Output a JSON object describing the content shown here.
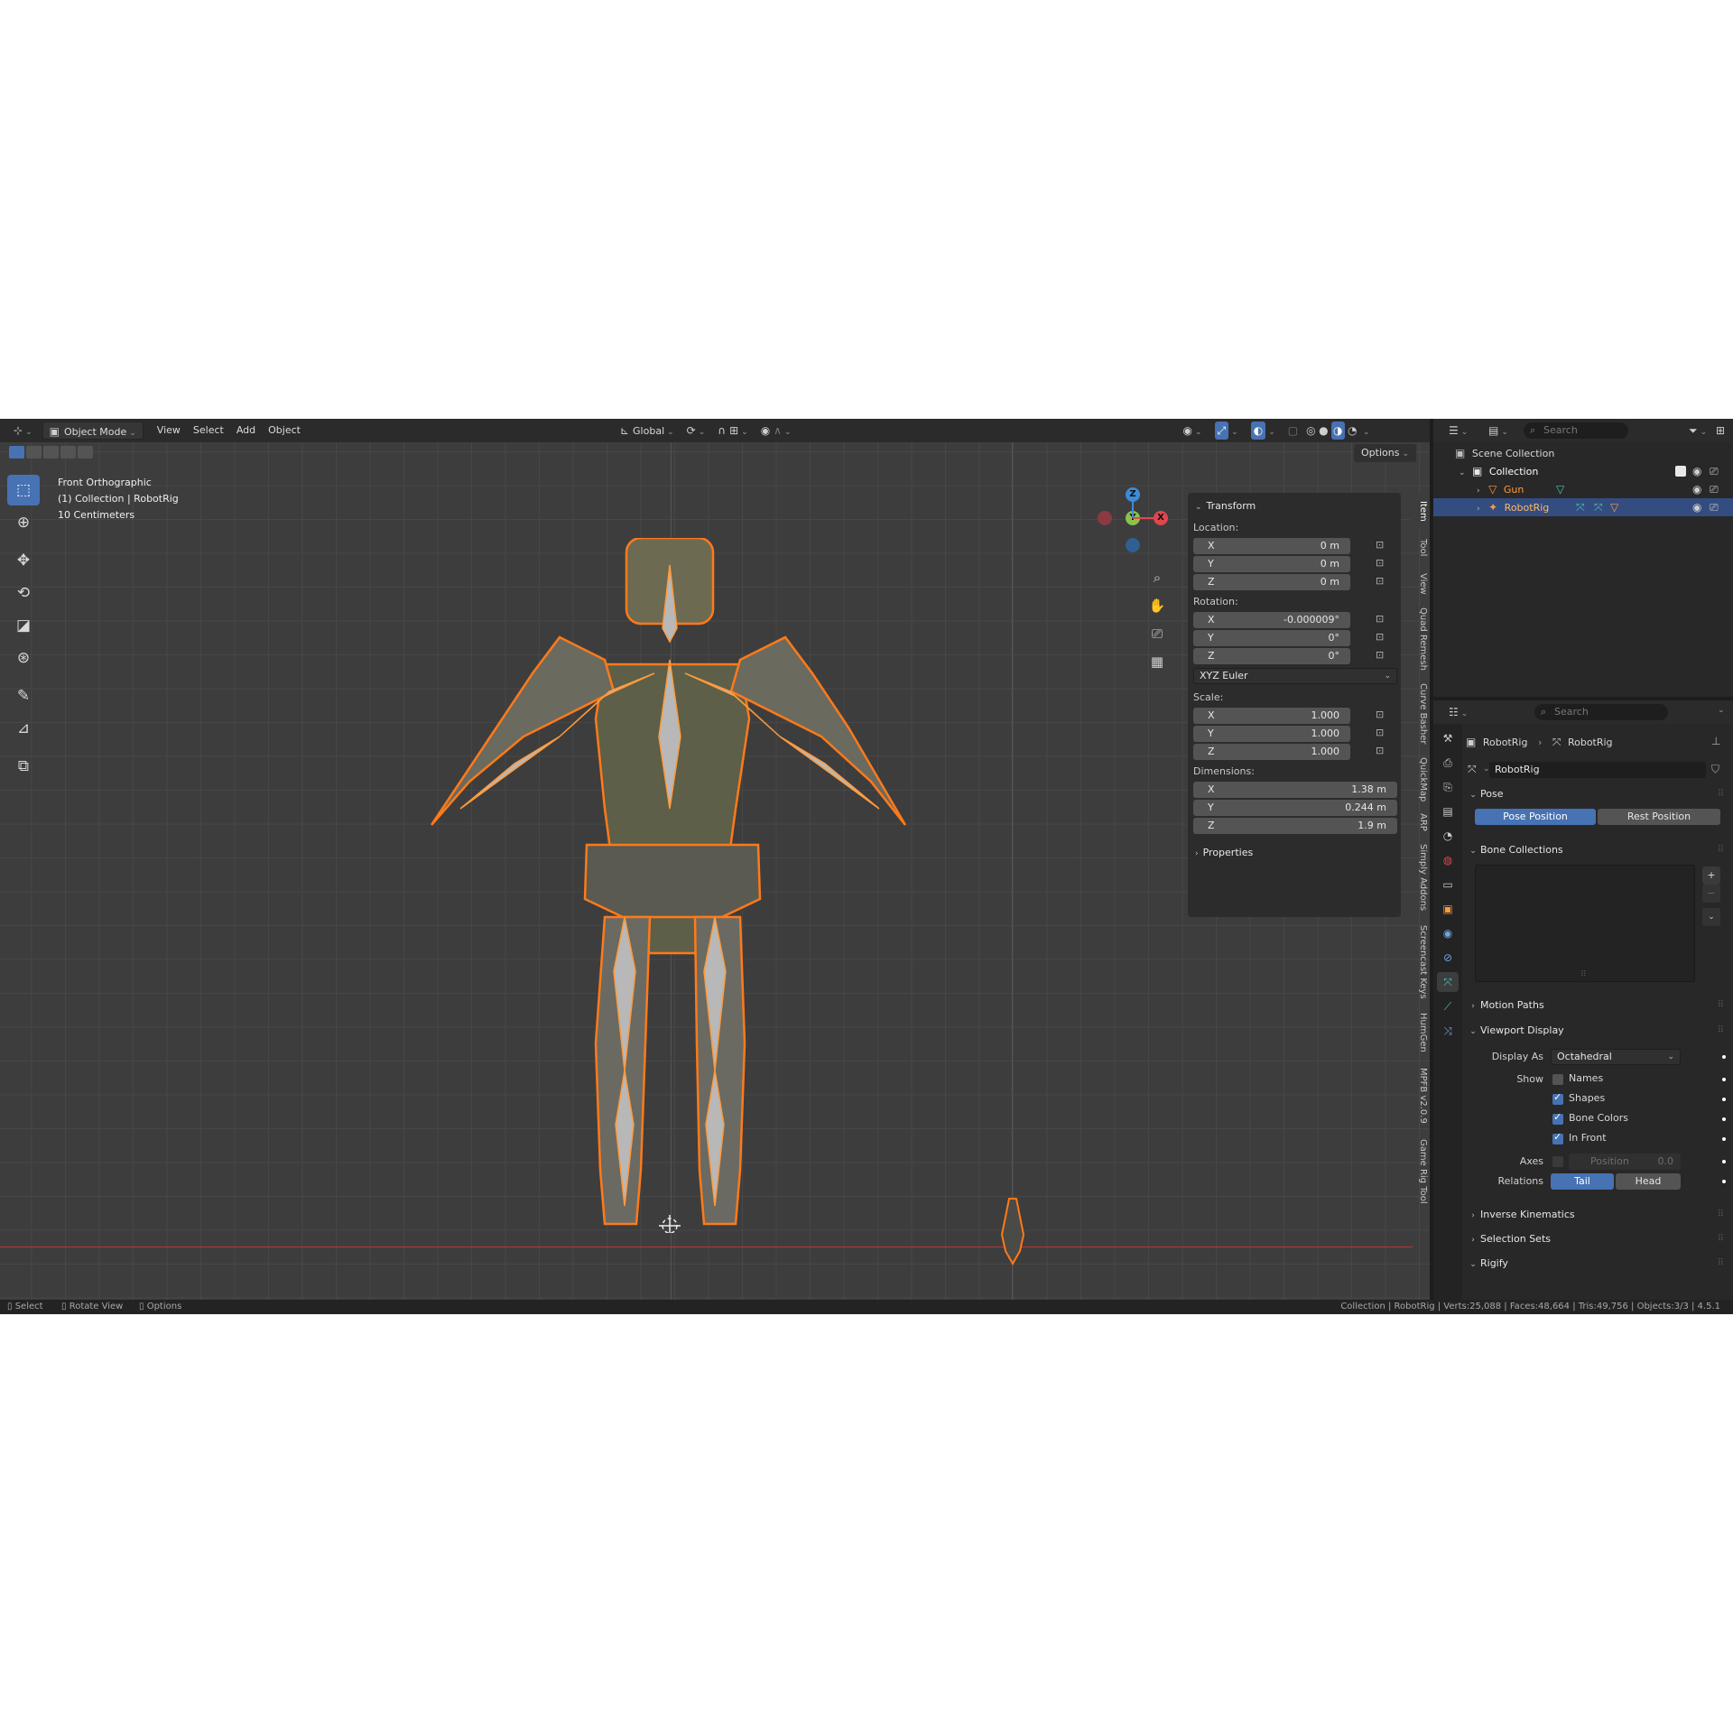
{
  "viewport": {
    "header": {
      "editor_icon": "3d-viewport-icon",
      "mode": "Object Mode",
      "menus": [
        "View",
        "Select",
        "Add",
        "Object"
      ],
      "orientation": "Global"
    },
    "options": "Options",
    "overlay_info": {
      "view_name": "Front Orthographic",
      "collection_object": "(1) Collection | RobotRig",
      "scale": "10 Centimeters"
    },
    "tools": [
      "select-box-icon",
      "cursor-icon",
      "move-icon",
      "rotate-icon",
      "scale-icon",
      "transform-icon",
      "annotate-icon",
      "measure-icon",
      "add-cube-icon"
    ],
    "gizmo": {
      "z": "Z",
      "y": "Y",
      "x": "X"
    },
    "nav_buttons": [
      "zoom-icon",
      "hand-pan-icon",
      "camera-icon",
      "grid-perspective-icon"
    ]
  },
  "npanel": {
    "transform_title": "Transform",
    "location_label": "Location:",
    "location": [
      {
        "axis": "X",
        "value": "0 m"
      },
      {
        "axis": "Y",
        "value": "0 m"
      },
      {
        "axis": "Z",
        "value": "0 m"
      }
    ],
    "rotation_label": "Rotation:",
    "rotation": [
      {
        "axis": "X",
        "value": "-0.000009°"
      },
      {
        "axis": "Y",
        "value": "0°"
      },
      {
        "axis": "Z",
        "value": "0°"
      }
    ],
    "rotation_mode": "XYZ Euler",
    "scale_label": "Scale:",
    "scale": [
      {
        "axis": "X",
        "value": "1.000"
      },
      {
        "axis": "Y",
        "value": "1.000"
      },
      {
        "axis": "Z",
        "value": "1.000"
      }
    ],
    "dimensions_label": "Dimensions:",
    "dimensions": [
      {
        "axis": "X",
        "value": "1.38 m"
      },
      {
        "axis": "Y",
        "value": "0.244 m"
      },
      {
        "axis": "Z",
        "value": "1.9 m"
      }
    ],
    "properties_title": "Properties"
  },
  "sidebar_tabs": [
    "Item",
    "Tool",
    "View",
    "Quad Remesh",
    "Curve Basher",
    "QuickMap",
    "ARP",
    "Simply Addons",
    "Screencast Keys",
    "HumGen",
    "MPFB v2.0.9",
    "Game Rig Tool"
  ],
  "outliner": {
    "search_placeholder": "Search",
    "scene_collection": "Scene Collection",
    "collection": "Collection",
    "items": [
      {
        "name": "Gun",
        "selected": false
      },
      {
        "name": "RobotRig",
        "selected": true
      }
    ]
  },
  "properties": {
    "search_placeholder": "Search",
    "breadcrumb": [
      "RobotRig",
      "RobotRig"
    ],
    "data_name": "RobotRig",
    "pose": {
      "title": "Pose",
      "pose_position": "Pose Position",
      "rest_position": "Rest Position"
    },
    "bone_collections": "Bone Collections",
    "motion_paths": "Motion Paths",
    "viewport_display": {
      "title": "Viewport Display",
      "display_as_label": "Display As",
      "display_as": "Octahedral",
      "show_label": "Show",
      "show": [
        {
          "label": "Names",
          "checked": false
        },
        {
          "label": "Shapes",
          "checked": true
        },
        {
          "label": "Bone Colors",
          "checked": true
        },
        {
          "label": "In Front",
          "checked": true
        }
      ],
      "axes_label": "Axes",
      "axes_position_label": "Position",
      "axes_position_value": "0.0",
      "relations_label": "Relations",
      "relations": [
        "Tail",
        "Head"
      ]
    },
    "collapsed_sections": [
      "Inverse Kinematics",
      "Selection Sets",
      "Rigify"
    ]
  },
  "statusbar": {
    "left": [
      "Select",
      "Rotate View",
      "Options"
    ],
    "right": "Collection | RobotRig | Verts:25,088 | Faces:48,664 | Tris:49,756 | Objects:3/3 | 4.5.1"
  },
  "colors": {
    "accent": "#4772b3",
    "selection_orange": "#ff7a1a",
    "x_axis": "#e0464e",
    "y_axis": "#8bc34a",
    "z_axis": "#3d8bd9"
  }
}
